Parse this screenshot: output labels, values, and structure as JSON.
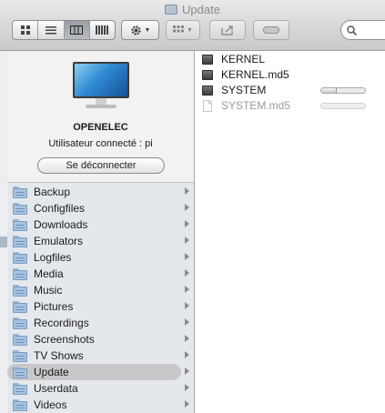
{
  "window": {
    "title": "Update"
  },
  "toolbar": {
    "search_placeholder": ""
  },
  "share": {
    "name": "OPENELEC",
    "user": "Utilisateur connecté : pi",
    "disconnect_label": "Se déconnecter"
  },
  "sidebar": {
    "folders": [
      {
        "label": "Backup"
      },
      {
        "label": "Configfiles"
      },
      {
        "label": "Downloads"
      },
      {
        "label": "Emulators"
      },
      {
        "label": "Logfiles"
      },
      {
        "label": "Media"
      },
      {
        "label": "Music"
      },
      {
        "label": "Pictures"
      },
      {
        "label": "Recordings"
      },
      {
        "label": "Screenshots"
      },
      {
        "label": "TV Shows"
      },
      {
        "label": "Update",
        "selected": true
      },
      {
        "label": "Userdata"
      },
      {
        "label": "Videos"
      }
    ]
  },
  "column": {
    "files": [
      {
        "name": "KERNEL",
        "type": "file"
      },
      {
        "name": "KERNEL.md5",
        "type": "file"
      },
      {
        "name": "SYSTEM",
        "type": "file",
        "progress": 0.35
      },
      {
        "name": "SYSTEM.md5",
        "type": "document",
        "dimmed": true,
        "progress": 0
      }
    ]
  },
  "colors": {
    "folder_blue": "#a7c3e0",
    "selection": "#c8c8c8",
    "sidebar_bg": "#e4e8ed"
  }
}
